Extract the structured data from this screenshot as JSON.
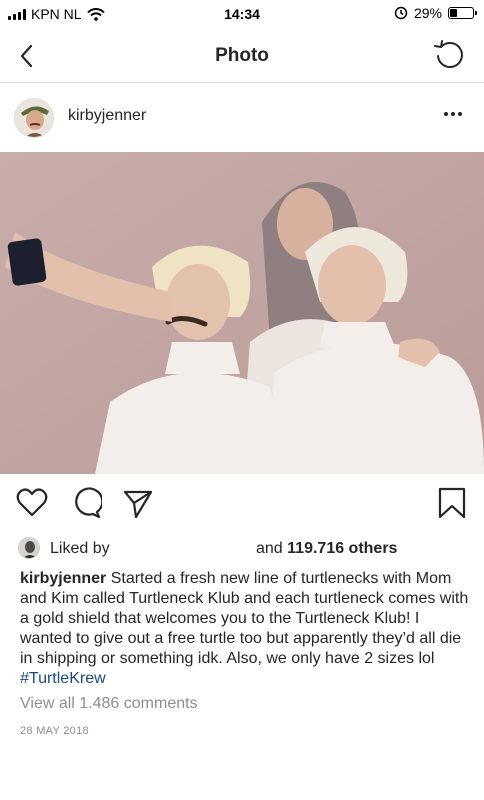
{
  "status_bar": {
    "carrier": "KPN NL",
    "time": "14:34",
    "battery_percent": "29%",
    "battery_level": 0.29
  },
  "nav": {
    "title": "Photo"
  },
  "post": {
    "username": "kirbyjenner",
    "liked_by_label": "Liked by",
    "liked_by_suffix": "and",
    "others": "119.716 others",
    "caption_user": "kirbyjenner",
    "caption_text": " Started a fresh new line of turtlenecks with Mom and Kim called Turtleneck Klub and each turtleneck comes with a gold shield that welcomes you to the Turtleneck Klub! I wanted to give out a free turtle too but apparently they’d all die in shipping or something idk. Also, we only have 2 sizes lol ",
    "hashtag": "#TurtleKrew",
    "view_comments": "View all 1.486 comments",
    "date": "28 MAY 2018"
  },
  "colors": {
    "hashtag": "#1a4a8a",
    "muted": "#8e8e8e",
    "photo_bg": "#c8aeaa"
  },
  "icons": [
    "wifi-icon",
    "alarm-icon",
    "battery-icon",
    "back-chevron-icon",
    "refresh-icon",
    "more-options-icon",
    "heart-icon",
    "comment-icon",
    "share-icon",
    "bookmark-icon"
  ]
}
